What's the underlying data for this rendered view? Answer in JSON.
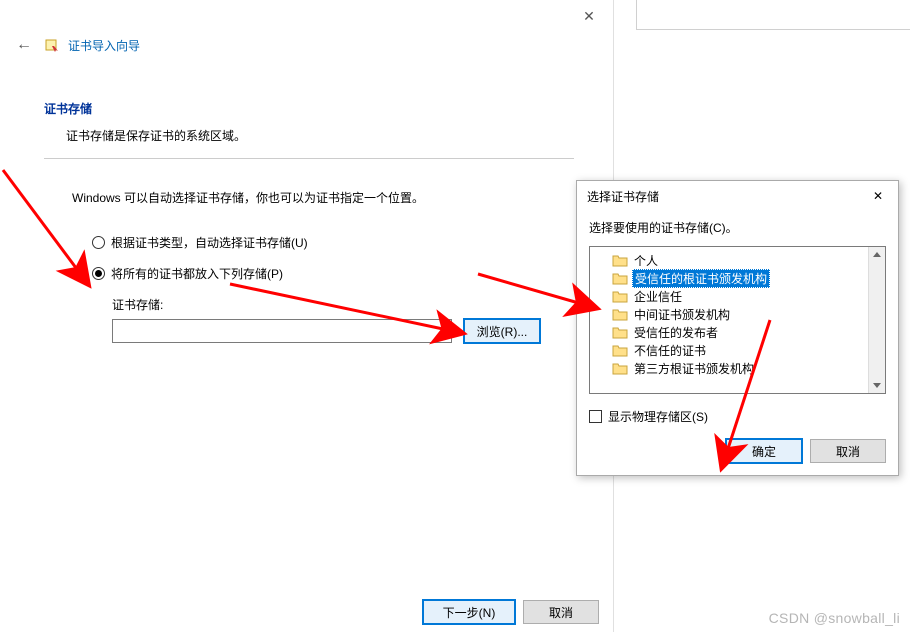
{
  "wizard": {
    "title": "证书导入向导",
    "section_title": "证书存储",
    "section_desc": "证书存储是保存证书的系统区域。",
    "instruction": "Windows 可以自动选择证书存储，你也可以为证书指定一个位置。",
    "radio_auto": "根据证书类型，自动选择证书存储(U)",
    "radio_manual": "将所有的证书都放入下列存储(P)",
    "store_label": "证书存储:",
    "store_value": "",
    "browse": "浏览(R)...",
    "next": "下一步(N)",
    "cancel": "取消"
  },
  "dlg": {
    "title": "选择证书存储",
    "prompt": "选择要使用的证书存储(C)。",
    "items": [
      "个人",
      "受信任的根证书颁发机构",
      "企业信任",
      "中间证书颁发机构",
      "受信任的发布者",
      "不信任的证书",
      "第三方根证书颁发机构"
    ],
    "show_physical": "显示物理存储区(S)",
    "ok": "确定",
    "cancel": "取消"
  },
  "watermark": "CSDN @snowball_li"
}
